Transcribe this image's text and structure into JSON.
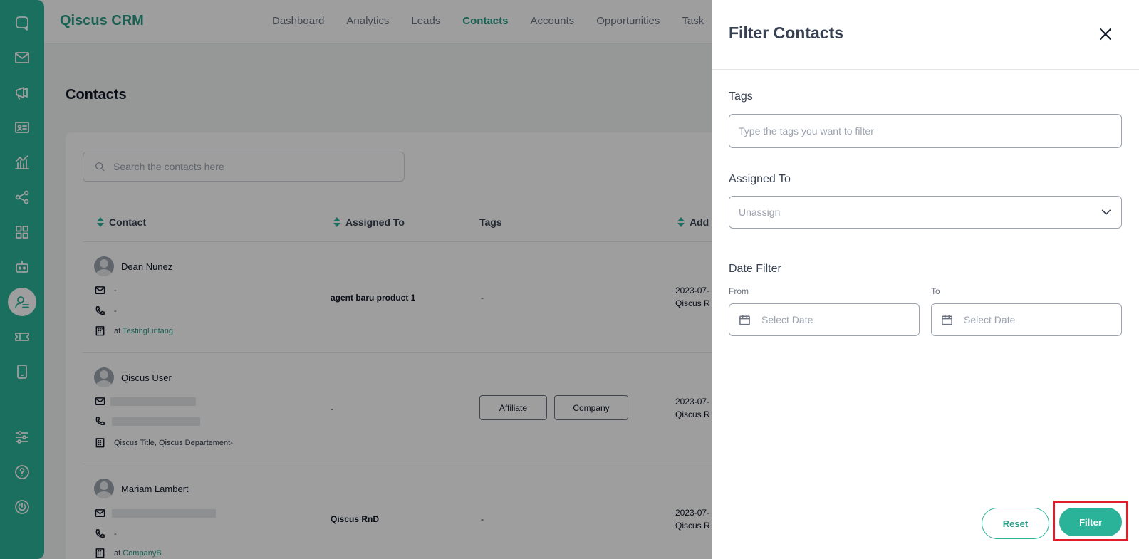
{
  "brand": {
    "name": "Qiscus CRM"
  },
  "nav": {
    "items": [
      "Dashboard",
      "Analytics",
      "Leads",
      "Contacts",
      "Accounts",
      "Opportunities",
      "Task"
    ],
    "active": "Contacts"
  },
  "rail": {
    "items": [
      "chat-icon",
      "mail-icon",
      "megaphone-icon",
      "contact-card-icon",
      "analytics-icon",
      "share-icon",
      "apps-icon",
      "bot-icon",
      "crm-contacts-icon",
      "ticket-icon",
      "mobile-icon",
      "settings-sliders-icon",
      "help-icon",
      "power-icon"
    ],
    "active": "crm-contacts-icon"
  },
  "page": {
    "title": "Contacts"
  },
  "search": {
    "placeholder": "Search the contacts here"
  },
  "table": {
    "headers": [
      "Contact",
      "Assigned To",
      "Tags",
      "Add"
    ],
    "rows": [
      {
        "name": "Dean Nunez",
        "email": "-",
        "phone": "-",
        "company_prefix": "at",
        "company": "TestingLintang",
        "assigned": "agent baru product 1",
        "tags_text": "-",
        "date": "2023-07-",
        "account": "Qiscus R"
      },
      {
        "name": "Qiscus User",
        "email": "",
        "phone": "",
        "company_text": "Qiscus Title, Qiscus Departement-",
        "assigned": "-",
        "tags": [
          "Affiliate",
          "Company"
        ],
        "date": "2023-07-",
        "account": "Qiscus R"
      },
      {
        "name": "Mariam Lambert",
        "email": "",
        "phone": "-",
        "company_prefix": "at",
        "company": "CompanyB",
        "assigned": "Qiscus RnD",
        "tags_text": "-",
        "date": "2023-07-",
        "account": "Qiscus R"
      }
    ]
  },
  "filter": {
    "title": "Filter Contacts",
    "tags_label": "Tags",
    "tags_placeholder": "Type the tags you want to filter",
    "assigned_label": "Assigned To",
    "assigned_value": "Unassign",
    "date_label": "Date Filter",
    "from_label": "From",
    "to_label": "To",
    "from_placeholder": "Select Date",
    "to_placeholder": "Select Date",
    "reset_label": "Reset",
    "filter_label": "Filter"
  },
  "colors": {
    "brand": "#2bb39a",
    "highlight": "#e11d2a"
  }
}
